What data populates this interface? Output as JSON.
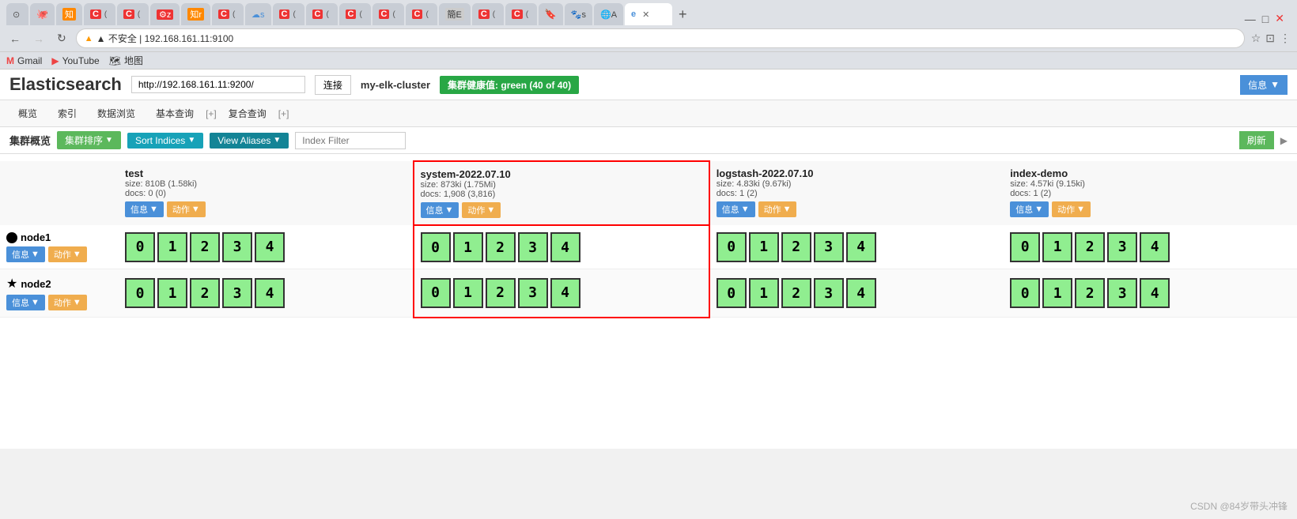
{
  "browser": {
    "tabs": [
      {
        "label": "e",
        "active": true,
        "favicon_color": "#4a90d9"
      },
      {
        "label": "+",
        "active": false,
        "is_plus": true
      }
    ],
    "address": "192.168.161.11:9100",
    "address_full": "▲ 不安全 | 192.168.161.11:9100",
    "bookmarks": [
      {
        "label": "Gmail",
        "icon": "M"
      },
      {
        "label": "YouTube",
        "icon": "▶"
      },
      {
        "label": "地图",
        "icon": "📍"
      }
    ]
  },
  "app": {
    "title": "Elasticsearch",
    "url_input": "http://192.168.161.11:9200/",
    "connect_label": "连接",
    "cluster_name": "my-elk-cluster",
    "health_label": "集群健康值: green (40 of 40)",
    "info_label": "信息",
    "nav_tabs": [
      {
        "label": "概览"
      },
      {
        "label": "索引"
      },
      {
        "label": "数据浏览"
      },
      {
        "label": "基本查询"
      },
      {
        "label": "[+]"
      },
      {
        "label": "复合查询"
      },
      {
        "label": "[+]"
      }
    ],
    "toolbar": {
      "page_title": "集群概览",
      "cluster_sort_label": "集群排序",
      "sort_indices_label": "Sort Indices",
      "view_aliases_label": "View Aliases",
      "index_filter_placeholder": "Index Filter",
      "refresh_label": "刷新"
    },
    "indices": [
      {
        "name": "test",
        "size": "size: 810B (1.58ki)",
        "docs": "docs: 0 (0)",
        "info_label": "信息",
        "action_label": "动作",
        "highlighted": false
      },
      {
        "name": "system-2022.07.10",
        "size": "size: 873ki (1.75Mi)",
        "docs": "docs: 1,908 (3,816)",
        "info_label": "信息",
        "action_label": "动作",
        "highlighted": true
      },
      {
        "name": "logstash-2022.07.10",
        "size": "size: 4.83ki (9.67ki)",
        "docs": "docs: 1 (2)",
        "info_label": "信息",
        "action_label": "动作",
        "highlighted": false
      },
      {
        "name": "index-demo",
        "size": "size: 4.57ki (9.15ki)",
        "docs": "docs: 1 (2)",
        "info_label": "信息",
        "action_label": "动作",
        "highlighted": false
      }
    ],
    "nodes": [
      {
        "name": "node1",
        "type": "dot",
        "info_label": "信息",
        "action_label": "动作",
        "shards_row1": [
          "0",
          "1",
          "2",
          "3",
          "4"
        ],
        "shards_row2": null
      },
      {
        "name": "node2",
        "type": "star",
        "info_label": "信息",
        "action_label": "动作",
        "shards_row1": [
          "0",
          "1",
          "2",
          "3",
          "4"
        ],
        "shards_row2": null
      }
    ],
    "shards_node1": {
      "test": [
        "0",
        "1",
        "2",
        "3",
        "4"
      ],
      "system": [
        "0",
        "1",
        "2",
        "3",
        "4"
      ],
      "logstash": [
        "0",
        "1",
        "2",
        "3",
        "4"
      ],
      "indexdemo": [
        "0",
        "1",
        "2",
        "3",
        "4"
      ]
    },
    "shards_node2": {
      "test": [
        "0",
        "1",
        "2",
        "3",
        "4"
      ],
      "system": [
        "0",
        "1",
        "2",
        "3",
        "4"
      ],
      "logstash": [
        "0",
        "1",
        "2",
        "3",
        "4"
      ],
      "indexdemo": [
        "0",
        "1",
        "2",
        "3",
        "4"
      ]
    }
  },
  "watermark": "CSDN @84岁带头冲锋"
}
